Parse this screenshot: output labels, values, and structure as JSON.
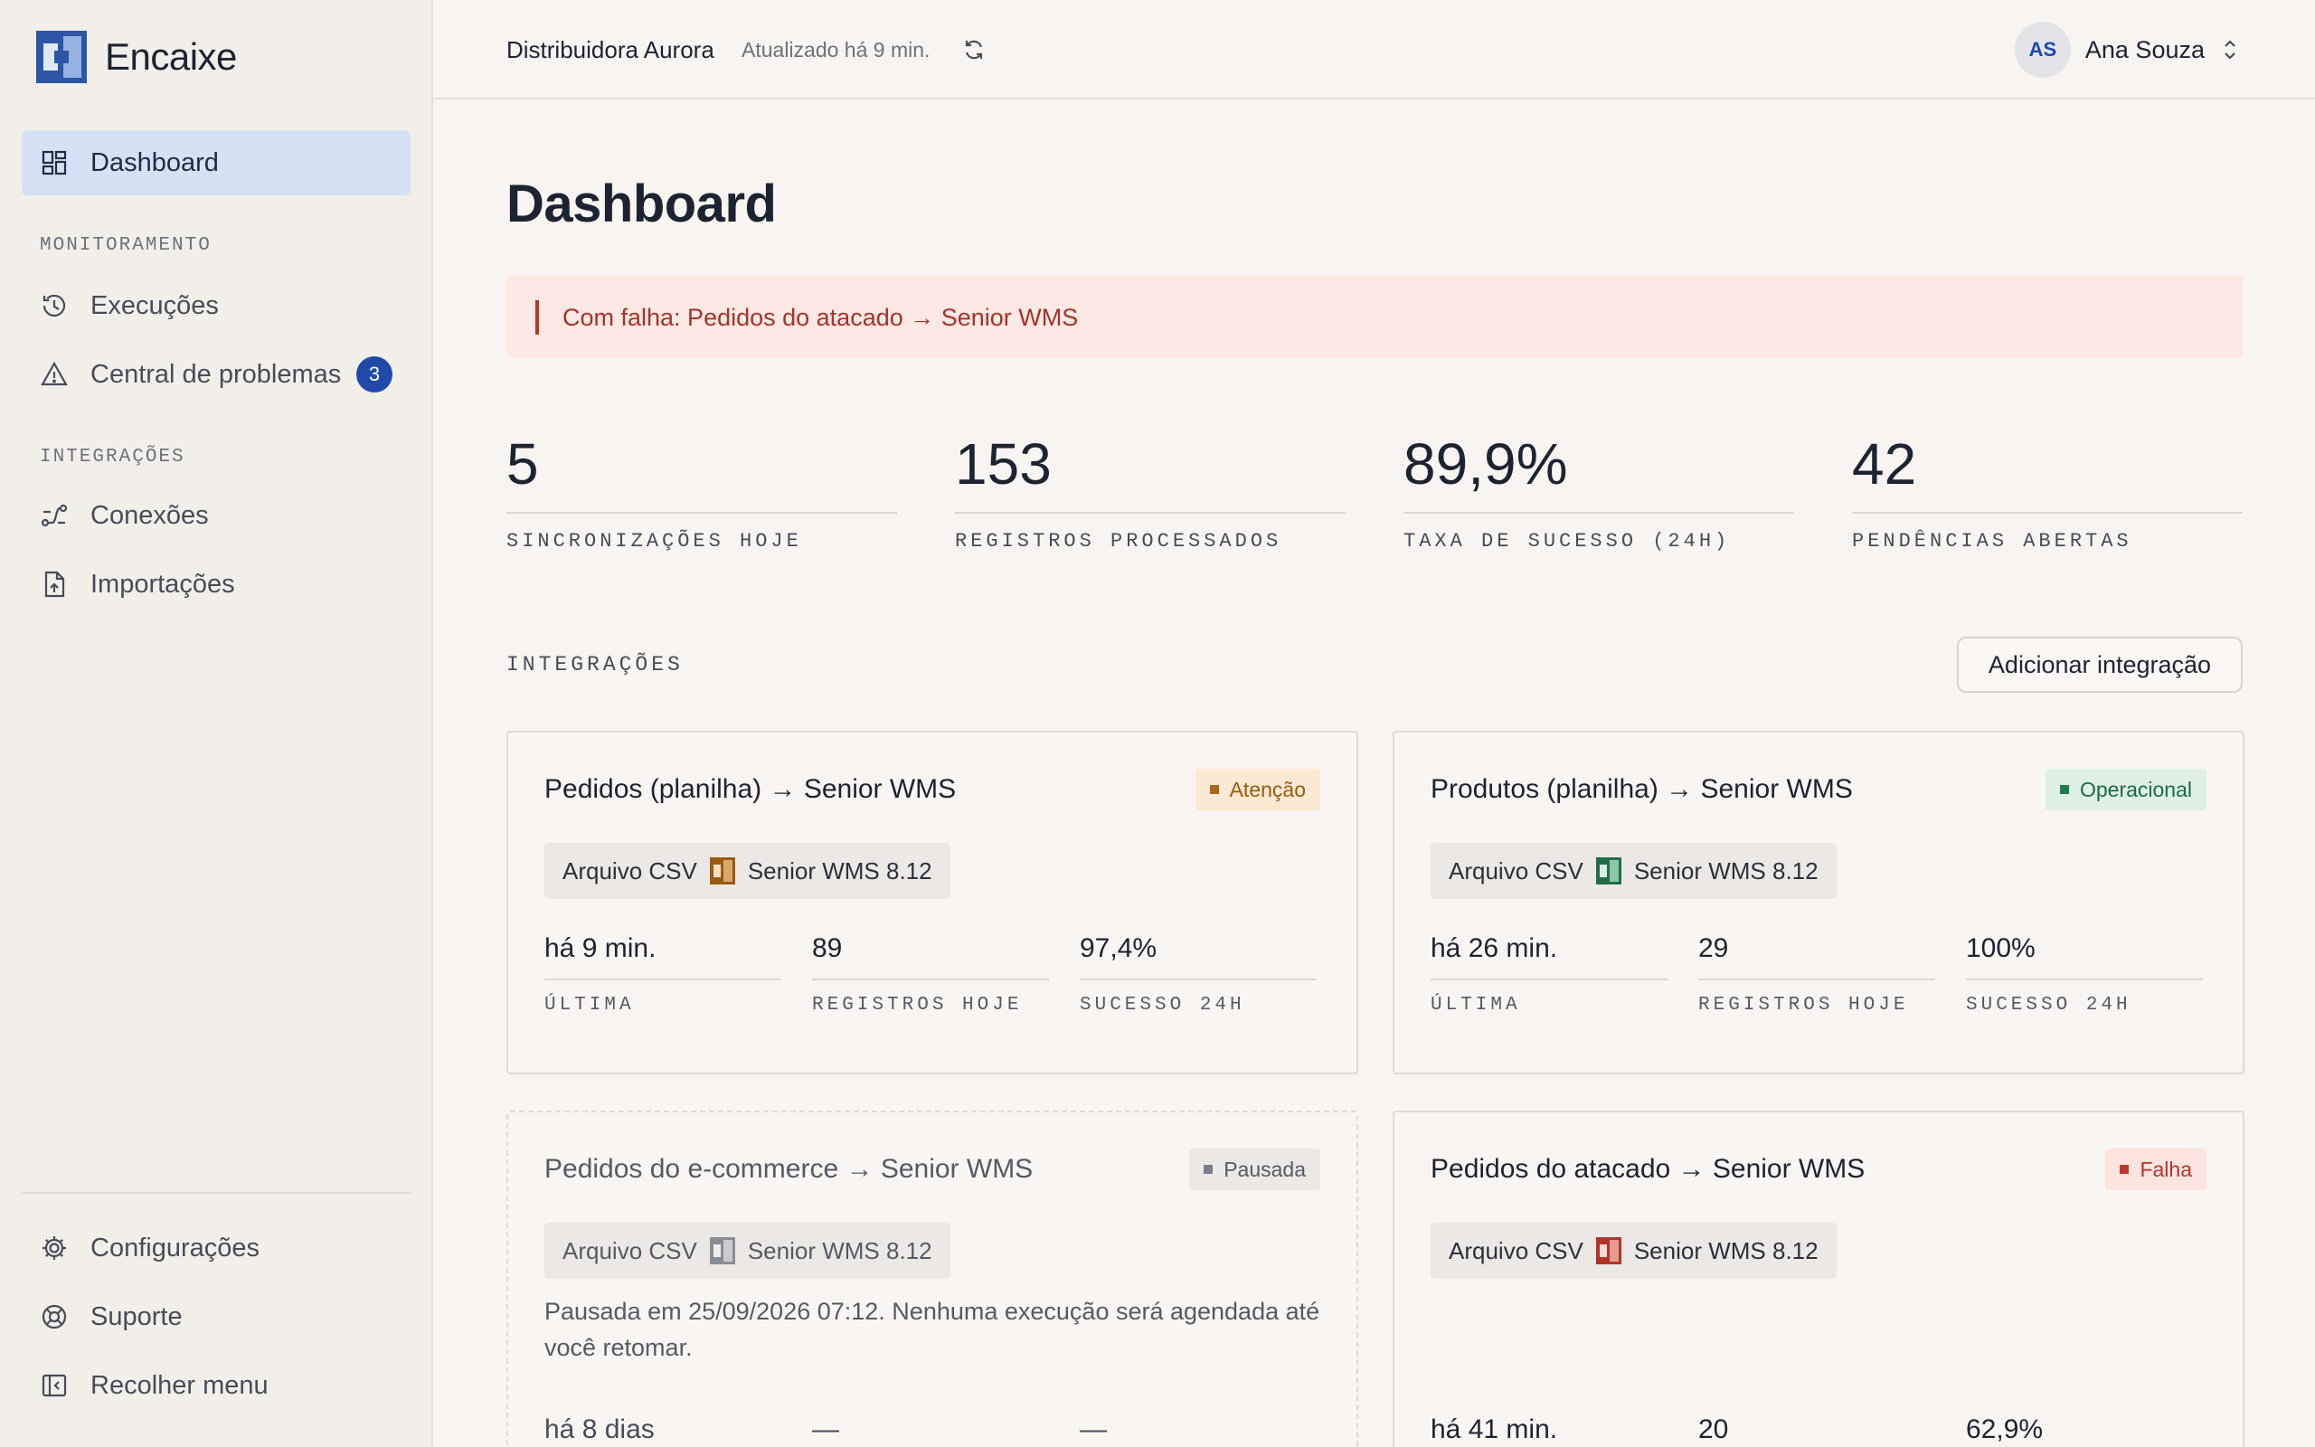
{
  "app": {
    "name": "Encaixe"
  },
  "sidebar": {
    "dashboard": "Dashboard",
    "section_monitoring": "MONITORAMENTO",
    "executions": "Execuções",
    "problems": "Central de problemas",
    "problems_badge": "3",
    "section_integrations": "INTEGRAÇÕES",
    "connections": "Conexões",
    "imports": "Importações",
    "settings": "Configurações",
    "support": "Suporte",
    "collapse": "Recolher menu"
  },
  "header": {
    "org": "Distribuidora Aurora",
    "updated": "Atualizado há 9 min.",
    "user_initials": "AS",
    "user_name": "Ana Souza"
  },
  "page": {
    "title": "Dashboard",
    "alert": "Com falha: Pedidos do atacado → Senior WMS"
  },
  "kpis": [
    {
      "value": "5",
      "label": "SINCRONIZAÇÕES HOJE"
    },
    {
      "value": "153",
      "label": "REGISTROS PROCESSADOS"
    },
    {
      "value": "89,9%",
      "label": "TAXA DE SUCESSO (24H)"
    },
    {
      "value": "42",
      "label": "PENDÊNCIAS ABERTAS"
    }
  ],
  "integrations": {
    "section_title": "INTEGRAÇÕES",
    "add_button": "Adicionar integração",
    "metric_labels": {
      "last": "ÚLTIMA",
      "records": "REGISTROS HOJE",
      "success": "SUCESSO 24H"
    },
    "cards": [
      {
        "title": "Pedidos (planilha) → Senior WMS",
        "status": "Atenção",
        "status_color": "#a7651e",
        "source": "Arquivo CSV",
        "target": "Senior WMS 8.12",
        "last": "há 9 min.",
        "records": "89",
        "success": "97,4%"
      },
      {
        "title": "Produtos (planilha) → Senior WMS",
        "status": "Operacional",
        "status_color": "#227a4e",
        "source": "Arquivo CSV",
        "target": "Senior WMS 8.12",
        "last": "há 26 min.",
        "records": "29",
        "success": "100%"
      },
      {
        "title": "Pedidos do e-commerce → Senior WMS",
        "status": "Pausada",
        "status_color": "#7a7e86",
        "source": "Arquivo CSV",
        "target": "Senior WMS 8.12",
        "note": "Pausada em 25/09/2026 07:12. Nenhuma execução será agendada até você retomar.",
        "last": "há 8 dias",
        "records": "—",
        "success": "—"
      },
      {
        "title": "Pedidos do atacado → Senior WMS",
        "status": "Falha",
        "status_color": "#c0382d",
        "source": "Arquivo CSV",
        "target": "Senior WMS 8.12",
        "last": "há 41 min.",
        "records": "20",
        "success": "62,9%"
      }
    ]
  },
  "colors": {
    "accent": "#1f4aa8",
    "active_nav_bg": "#d6e2f4",
    "alert_bg": "#fde9e4",
    "alert_text": "#a8322a"
  }
}
